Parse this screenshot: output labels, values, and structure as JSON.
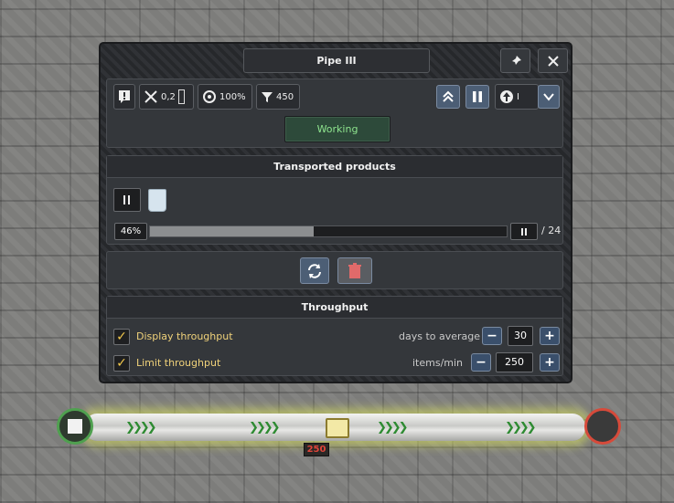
{
  "window": {
    "title": "Pipe III"
  },
  "header": {
    "pin_icon": "pin-icon",
    "close_icon": "close-icon"
  },
  "toolbar": {
    "maintenance_value": "0,2",
    "electricity_value": "100%",
    "filter_value": "450",
    "priority_value": "I"
  },
  "status": {
    "label": "Working"
  },
  "transported": {
    "title": "Transported products",
    "progress_label": "46%",
    "progress_fraction": 0.46,
    "capacity_label": "/ 24"
  },
  "throughput": {
    "title": "Throughput",
    "display_label": "Display throughput",
    "display_checked": true,
    "days_label": "days to average",
    "days_value": "30",
    "limit_label": "Limit throughput",
    "limit_checked": true,
    "items_label": "items/min",
    "items_value": "250"
  },
  "world": {
    "pipe_throughput_tag": "250"
  },
  "colors": {
    "accent_blue": "#4c5e75",
    "status_green": "#8ee48e",
    "label_yellow": "#f0d27a",
    "tag_red": "#e0453a"
  }
}
